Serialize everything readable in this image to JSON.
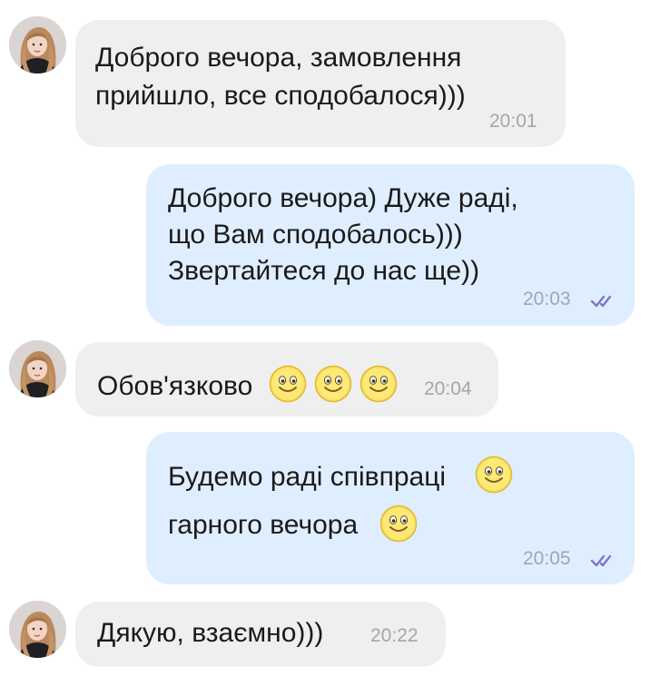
{
  "colors": {
    "incoming_bubble": "#efefef",
    "outgoing_bubble": "#dfeeff",
    "read_check": "#7e76c9",
    "smiley_yellow": "#fbe35b"
  },
  "messages": [
    {
      "direction": "incoming",
      "lines": [
        "Доброго вечора, замовлення",
        "прийшло, все сподобалося)))"
      ],
      "time": "20:01"
    },
    {
      "direction": "outgoing",
      "lines": [
        "Доброго вечора) Дуже раді,",
        "що Вам сподобалось)))",
        "Звертайтеся до нас ще))"
      ],
      "time": "20:03",
      "status_icon": "double-check-icon"
    },
    {
      "direction": "incoming",
      "lines": [
        "Обов'язково"
      ],
      "emoji": [
        "smiley-icon",
        "smiley-icon",
        "smiley-icon"
      ],
      "time": "20:04"
    },
    {
      "direction": "outgoing",
      "lines": [
        "Будемо раді співпраці",
        "гарного вечора"
      ],
      "emoji": [
        "smiley-icon",
        "smiley-icon"
      ],
      "time": "20:05",
      "status_icon": "double-check-icon"
    },
    {
      "direction": "incoming",
      "lines": [
        "Дякую, взаємно)))"
      ],
      "time": "20:22"
    }
  ]
}
